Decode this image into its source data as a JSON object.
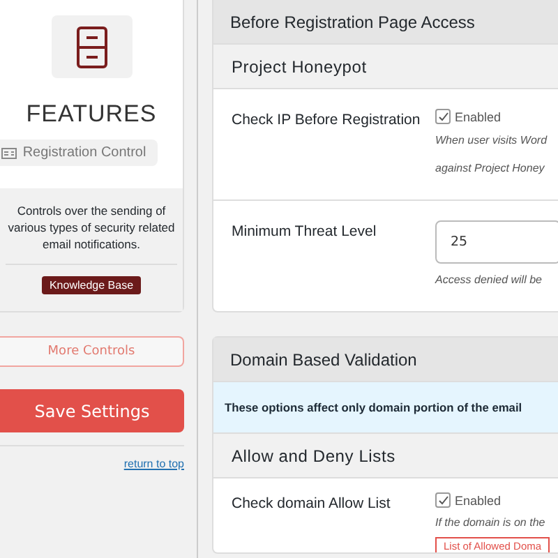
{
  "sidebar": {
    "title": "FEATURES",
    "feature": "Registration Control",
    "description": "Controls over the sending of various types of security related email notifications.",
    "badge": "Knowledge Base",
    "more_button": "More Controls",
    "save_button": "Save Settings",
    "return_link": "return to top"
  },
  "sections": [
    {
      "title": "Before Registration Page Access",
      "subsections": [
        {
          "title": "Project Honeypot",
          "rows": [
            {
              "kind": "checkbox",
              "label": "Check IP Before Registration",
              "option": "Enabled",
              "checked": true,
              "help": [
                "When user visits Word",
                "against Project Honey"
              ]
            },
            {
              "kind": "input",
              "label": "Minimum Threat Level",
              "value": "25",
              "help": [
                "Access denied will be"
              ]
            }
          ]
        }
      ]
    },
    {
      "title": "Domain Based Validation",
      "info": "These options affect only domain portion of the email",
      "subsections": [
        {
          "title": "Allow and Deny Lists",
          "rows": [
            {
              "kind": "checkbox",
              "label": "Check domain Allow List",
              "option": "Enabled",
              "checked": true,
              "help": [
                "If the domain is on the"
              ],
              "list_placeholder": "List of Allowed Doma"
            }
          ]
        }
      ]
    }
  ]
}
